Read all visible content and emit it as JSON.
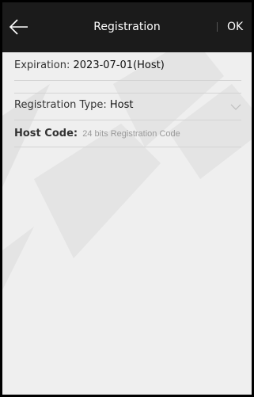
{
  "header": {
    "title": "Registration",
    "ok_label": "OK"
  },
  "expiration": {
    "label": "Expiration:",
    "value": "2023-07-01(Host)"
  },
  "registration_type": {
    "label": "Registration Type:",
    "value": "Host"
  },
  "host_code": {
    "label": "Host Code:",
    "placeholder": "24 bits Registration Code",
    "value": ""
  },
  "icons": {
    "back": "arrow-left-icon",
    "dropdown": "chevron-down-icon"
  },
  "colors": {
    "header_bg": "#1b1b1b",
    "content_bg": "#efefef",
    "divider": "#d3d3d3",
    "placeholder_text": "#9a9a9a"
  }
}
